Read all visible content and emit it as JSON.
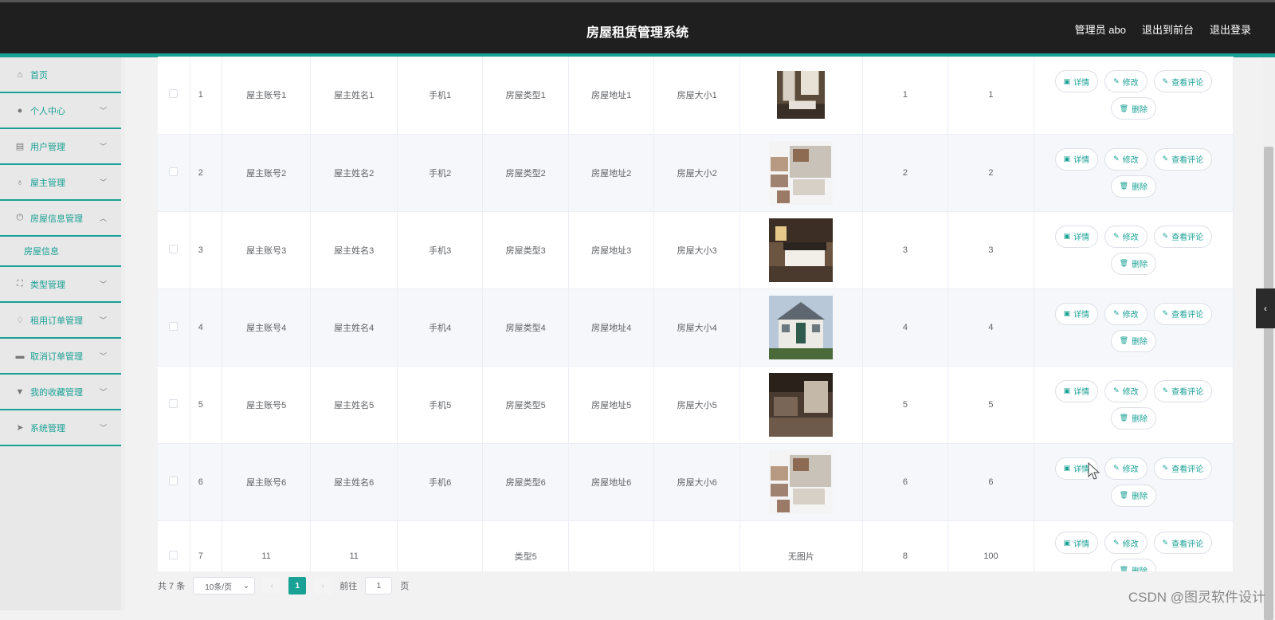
{
  "header": {
    "title": "房屋租赁管理系统",
    "admin": "管理员 abo",
    "to_front": "退出到前台",
    "logout": "退出登录"
  },
  "sidebar": {
    "items": [
      {
        "label": "首页",
        "icon": "home-icon"
      },
      {
        "label": "个人中心",
        "icon": "user-icon"
      },
      {
        "label": "用户管理",
        "icon": "list-icon"
      },
      {
        "label": "屋主管理",
        "icon": "mic-icon"
      },
      {
        "label": "房屋信息管理",
        "icon": "power-icon",
        "sub": "房屋信息"
      },
      {
        "label": "类型管理",
        "icon": "frame-icon"
      },
      {
        "label": "租用订单管理",
        "icon": "bulb-icon"
      },
      {
        "label": "取消订单管理",
        "icon": "briefcase-icon"
      },
      {
        "label": "我的收藏管理",
        "icon": "cup-icon"
      },
      {
        "label": "系统管理",
        "icon": "send-icon"
      }
    ]
  },
  "table": {
    "rows": [
      {
        "no": "1",
        "account": "屋主账号1",
        "name": "屋主姓名1",
        "phone": "手机1",
        "type": "房屋类型1",
        "address": "房屋地址1",
        "size": "房屋大小1",
        "image": "room-photo-livingroom",
        "c1": "1",
        "c2": "1"
      },
      {
        "no": "2",
        "account": "屋主账号2",
        "name": "屋主姓名2",
        "phone": "手机2",
        "type": "房屋类型2",
        "address": "房屋地址2",
        "size": "房屋大小2",
        "image": "room-photo-collage",
        "c1": "2",
        "c2": "2"
      },
      {
        "no": "3",
        "account": "屋主账号3",
        "name": "屋主姓名3",
        "phone": "手机3",
        "type": "房屋类型3",
        "address": "房屋地址3",
        "size": "房屋大小3",
        "image": "room-photo-bedroom",
        "c1": "3",
        "c2": "3"
      },
      {
        "no": "4",
        "account": "屋主账号4",
        "name": "屋主姓名4",
        "phone": "手机4",
        "type": "房屋类型4",
        "address": "房屋地址4",
        "size": "房屋大小4",
        "image": "house-photo-villa",
        "c1": "4",
        "c2": "4"
      },
      {
        "no": "5",
        "account": "屋主账号5",
        "name": "屋主姓名5",
        "phone": "手机5",
        "type": "房屋类型5",
        "address": "房屋地址5",
        "size": "房屋大小5",
        "image": "room-photo-suite",
        "c1": "5",
        "c2": "5"
      },
      {
        "no": "6",
        "account": "屋主账号6",
        "name": "屋主姓名6",
        "phone": "手机6",
        "type": "房屋类型6",
        "address": "房屋地址6",
        "size": "房屋大小6",
        "image": "room-photo-collage",
        "c1": "6",
        "c2": "6"
      },
      {
        "no": "7",
        "account": "11",
        "name": "11",
        "phone": "",
        "type": "类型5",
        "address": "",
        "size": "",
        "image_text": "无图片",
        "c1": "8",
        "c2": "100"
      }
    ],
    "actions": {
      "detail": "详情",
      "edit": "修改",
      "comments": "查看评论",
      "delete": "删除"
    }
  },
  "pagination": {
    "total": "共 7 条",
    "page_size": "10条/页",
    "current": "1",
    "goto_prefix": "前往",
    "goto_value": "1",
    "goto_suffix": "页"
  },
  "watermark": "CSDN @图灵软件设计"
}
